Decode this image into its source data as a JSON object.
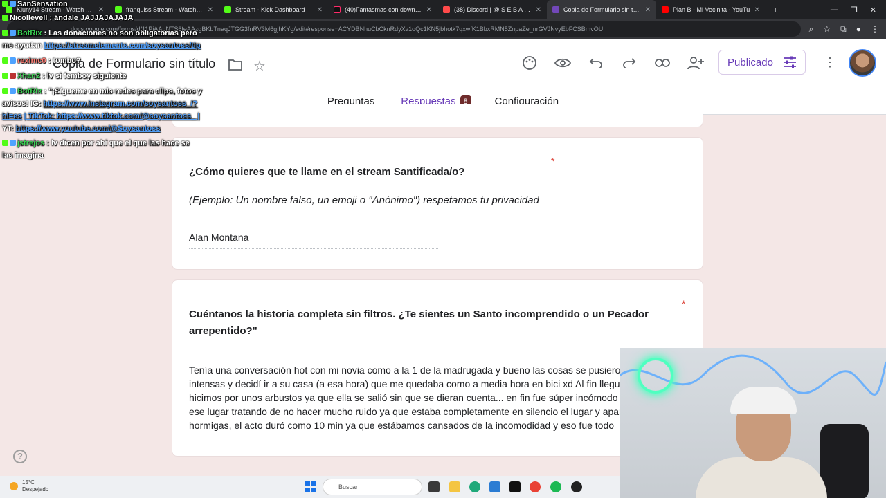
{
  "browser": {
    "tabs": [
      {
        "label": "Kluny14 Stream - Watch Live o",
        "color": "#53fc18",
        "active": false
      },
      {
        "label": "franquiss Stream - Watch Live o",
        "color": "#53fc18",
        "active": false
      },
      {
        "label": "Stream - Kick Dashboard",
        "color": "#53fc18",
        "active": false
      },
      {
        "label": "(40)Fantasmas con down | TikT",
        "color": "#111111",
        "active": false
      },
      {
        "label": "(38) Discord | @ S E B A S X H A",
        "color": "#5865f2",
        "active": false
      },
      {
        "label": "Copia de Formulario sin título",
        "color": "#7248b9",
        "active": true
      },
      {
        "label": "Plan B - Mi Vecinita - YouTu",
        "color": "#ff0000",
        "active": false
      }
    ],
    "new_tab": "+",
    "url": "docs.google.com/forms/d/11PiAAbNTS6feAAzgBKbTnaqJTGG3fnRV3M6gjhKYg/edit#response=ACYDBNhuCbCknRdyXv1oQc1KN5jbhotk7qxwfK1BbxRMN5ZnpaZe_nrGVJNvyEbFCSBmvOU"
  },
  "form_header": {
    "doc_title": "Copia de Formulario sin título",
    "publish_label": "Publicado",
    "tabs": [
      {
        "label": "Preguntas",
        "active": false
      },
      {
        "label": "Respuestas",
        "active": true,
        "count": "8"
      },
      {
        "label": "Configuración",
        "active": false
      }
    ]
  },
  "questions": [
    {
      "title": "¿Cómo quieres que te llame en el stream Santificada/o?",
      "description": "(Ejemplo: Un nombre falso, un emoji o \"Anónimo\") respetamos tu privacidad",
      "answer": "Alan Montana",
      "required_mark": "*"
    },
    {
      "title_line1": "Cuéntanos la historia completa sin filtros. ¿Te sientes un Santo incomprendido o un Pecador",
      "title_line2": "arrepentido?\"",
      "required_mark": "*",
      "answer_lines": [
        "Tenía una conversación hot con mi novia como a la 1 de la madrugada y bueno las cosas se pusieron",
        "intensas y decidí ir a su casa (a esa hora) que me quedaba como a media hora en bici xd Al fin llegué",
        "hicimos por unos arbustos ya que ella se salió sin que se dieran cuenta... en fin fue súper incómodo",
        "ese lugar tratando de no hacer mucho ruido ya que estaba completamente en silencio el lugar y aparte",
        "hormigas, el acto duró como 10 min ya que estábamos cansados de la incomodidad y eso fue todo"
      ]
    }
  ],
  "chat": [
    {
      "user": "SanSensation",
      "text": "",
      "user_color": "#ffffff"
    },
    {
      "user": "Nicollevell",
      "text": ": ándale JAJJAJAJAJA",
      "user_color": "#ffffff"
    },
    {
      "user": "BotRix",
      "text": ": Las donaciones no son obligatorias pero",
      "user_color": "#39d353"
    },
    {
      "user": "",
      "text": "me ayudan",
      "link": "https://streamelements.com/soysantoss/tip",
      "user_color": "#ffffff"
    },
    {
      "user": "reximc0",
      "text": ": tombo?",
      "user_color": "#ff7b72"
    },
    {
      "user": "Xhan2",
      "text": ": lv si femboy siguiente",
      "user_color": "#39d353"
    },
    {
      "user": "BotRix",
      "text": ": \"¡Sígueme en mis redes para clips, fotos y",
      "user_color": "#39d353"
    },
    {
      "user": "",
      "text": "avisos!  IG:",
      "link": "https://www.instagram.com/soysantoss_/?",
      "user_color": "#ffffff"
    },
    {
      "user": "",
      "text": "hl=es",
      "link2": "| TikTok: https://www.tiktok.com/@soysantoss_ |",
      "user_color": "#ffffff"
    },
    {
      "user": "",
      "text": "YT:",
      "link": "https://www.youtube.com/@Soysantoss",
      "user_color": "#ffffff"
    },
    {
      "user": "jstrejos",
      "text": ": lv dicen por ahí que el que las hace se",
      "user_color": "#39d353"
    },
    {
      "user": "",
      "text": "las imagina",
      "user_color": "#ffffff"
    }
  ],
  "taskbar": {
    "temperature": "15°C",
    "weather": "Despejado",
    "search_placeholder": "Buscar"
  },
  "colors": {
    "accent": "#673ab7",
    "background": "#f4e7e6",
    "badge": "#6e2b2b",
    "required": "#d93025"
  }
}
